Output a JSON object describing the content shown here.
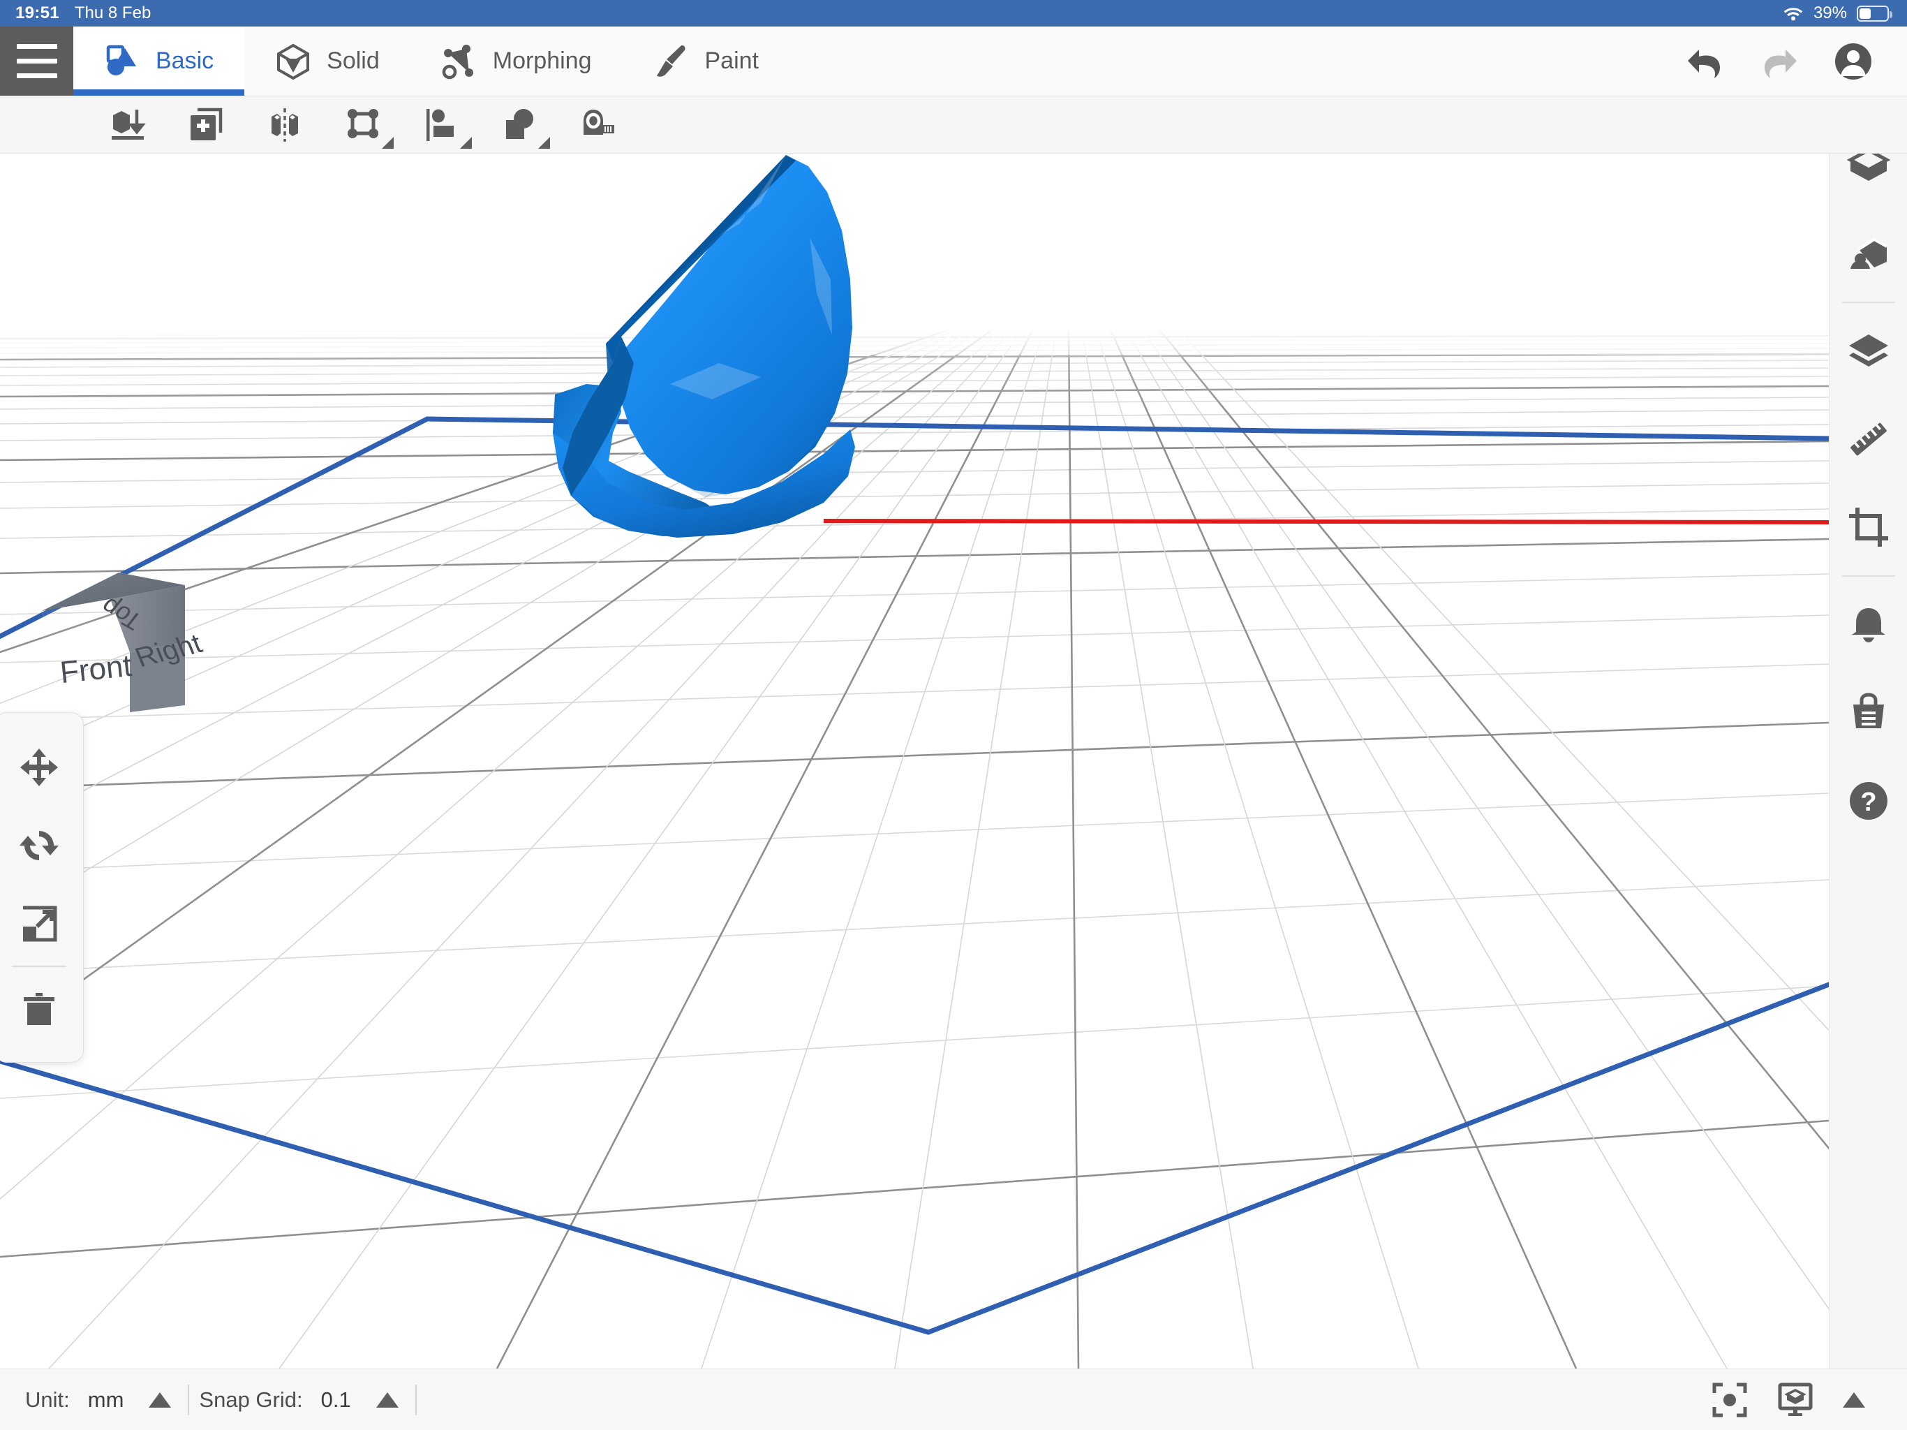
{
  "status_bar": {
    "time": "19:51",
    "date": "Thu 8 Feb",
    "wifi_icon": "wifi-icon",
    "battery_percent": "39%",
    "battery_level": 39,
    "bar_color": "#3d6bb0"
  },
  "topbar": {
    "menu_icon": "hamburger-icon",
    "tabs": [
      {
        "label": "Basic",
        "icon": "basic-shapes-icon",
        "active": true
      },
      {
        "label": "Solid",
        "icon": "solid-cube-icon",
        "active": false
      },
      {
        "label": "Morphing",
        "icon": "morphing-icon",
        "active": false
      },
      {
        "label": "Paint",
        "icon": "paint-brush-icon",
        "active": false
      }
    ],
    "actions": [
      {
        "name": "undo-button",
        "icon": "undo-icon",
        "enabled": true
      },
      {
        "name": "redo-button",
        "icon": "redo-icon",
        "enabled": false
      },
      {
        "name": "account-button",
        "icon": "account-circle-icon",
        "enabled": true
      }
    ],
    "accent_color": "#2f6bc4"
  },
  "toolbar": {
    "buttons": [
      {
        "name": "drop-to-floor-button",
        "icon": "drop-to-floor-icon",
        "has_menu": false
      },
      {
        "name": "add-object-button",
        "icon": "add-object-icon",
        "has_menu": false
      },
      {
        "name": "mirror-button",
        "icon": "mirror-icon",
        "has_menu": false
      },
      {
        "name": "transform-button",
        "icon": "transform-box-icon",
        "has_menu": true
      },
      {
        "name": "align-button",
        "icon": "align-icon",
        "has_menu": true
      },
      {
        "name": "boolean-button",
        "icon": "boolean-combine-icon",
        "has_menu": true
      },
      {
        "name": "measure-button",
        "icon": "measure-tape-icon",
        "has_menu": false
      }
    ]
  },
  "left_tools": {
    "buttons": [
      {
        "name": "move-tool",
        "icon": "move-arrows-icon"
      },
      {
        "name": "rotate-tool",
        "icon": "rotate-icon"
      },
      {
        "name": "scale-tool",
        "icon": "scale-icon"
      },
      {
        "name": "delete-tool",
        "icon": "trash-icon"
      }
    ]
  },
  "right_rail": {
    "buttons": [
      {
        "name": "objects-button",
        "icon": "cube-icon"
      },
      {
        "name": "scene-button",
        "icon": "scene-perspective-icon"
      },
      {
        "name": "layers-button",
        "icon": "layers-icon"
      },
      {
        "name": "ruler-button",
        "icon": "ruler-icon"
      },
      {
        "name": "crop-button",
        "icon": "crop-icon"
      },
      {
        "name": "notifications-button",
        "icon": "bell-icon"
      },
      {
        "name": "store-button",
        "icon": "shopping-bag-icon"
      },
      {
        "name": "help-button",
        "icon": "help-question-icon"
      }
    ]
  },
  "viewport": {
    "view_cube": {
      "top_label": "Top",
      "front_label": "Front",
      "right_label": "Right"
    },
    "model": {
      "name": "blue-faceted-dome-model",
      "fill_color": "#1f8fee",
      "shade_light": "#2e9bf5",
      "shade_mid": "#1178d8",
      "shade_dark": "#0a5fae",
      "edge_color": "#06457f"
    },
    "axes": {
      "x_axis_color": "#e01b1b",
      "y_axis_color": "#2bc62b",
      "z_axis_color": "#2f5fb0",
      "grid_minor_color": "#d8d8d8",
      "grid_major_color": "#8d8d8d",
      "build_plate_edge_color": "#2f5fb0"
    }
  },
  "bottom_bar": {
    "unit_label": "Unit:",
    "unit_value": "mm",
    "snap_label": "Snap Grid:",
    "snap_value": "0.1",
    "right_buttons": [
      {
        "name": "center-view-button",
        "icon": "focus-target-icon"
      },
      {
        "name": "display-mode-button",
        "icon": "display-cube-icon"
      },
      {
        "name": "expand-panel-button",
        "icon": "caret-up-icon"
      }
    ]
  }
}
